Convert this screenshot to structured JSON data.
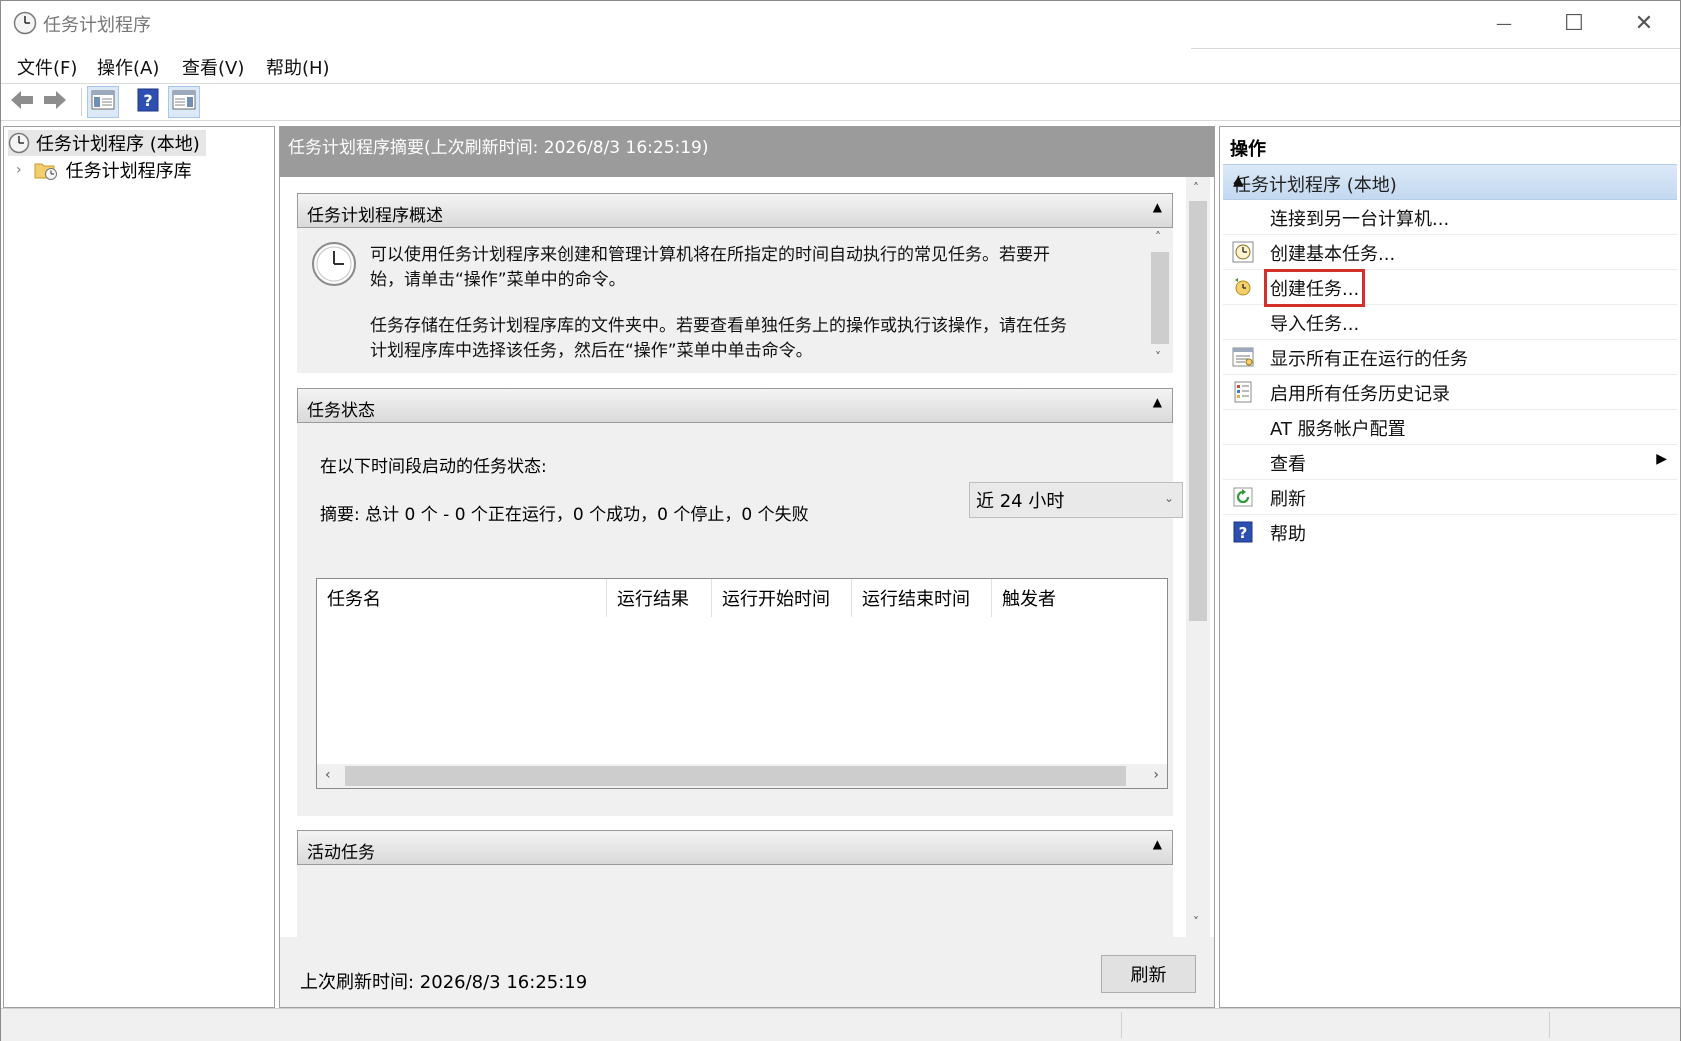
{
  "window": {
    "title": "任务计划程序",
    "controls": {
      "minimize": "—",
      "maximize": "☐",
      "close": "✕"
    }
  },
  "menubar": {
    "items": [
      "文件(F)",
      "操作(A)",
      "查看(V)",
      "帮助(H)"
    ]
  },
  "toolbar": {
    "icons": [
      "back-arrow-icon",
      "forward-arrow-icon",
      "show-hide-console-tree-icon",
      "help-icon",
      "show-hide-action-pane-icon"
    ]
  },
  "tree": {
    "root_label": "任务计划程序 (本地)",
    "child_label": "任务计划程序库"
  },
  "center": {
    "header": "任务计划程序摘要(上次刷新时间: 2026/8/3 16:25:19)",
    "overview": {
      "title": "任务计划程序概述",
      "line1": "可以使用任务计划程序来创建和管理计算机将在所指定的时间自动执行的常见任务。若要开",
      "line2": "始，请单击“操作”菜单中的命令。",
      "line3": "任务存储在任务计划程序库的文件夹中。若要查看单独任务上的操作或执行该操作，请在任务",
      "line4": "计划程序库中选择该任务，然后在“操作”菜单中单击命令。"
    },
    "status": {
      "title": "任务状态",
      "period_label": "在以下时间段启动的任务状态:",
      "period_value": "近 24 小时",
      "summary": "摘要: 总计 0 个 - 0 个正在运行，0 个成功，0 个停止，0 个失败",
      "columns": [
        "任务名",
        "运行结果",
        "运行开始时间",
        "运行结束时间",
        "触发者"
      ]
    },
    "active": {
      "title": "活动任务"
    },
    "footer": {
      "last_refresh": "上次刷新时间: 2026/8/3 16:25:19",
      "refresh_button": "刷新"
    }
  },
  "actions": {
    "title": "操作",
    "group": "任务计划程序 (本地)",
    "items": [
      {
        "label": "连接到另一台计算机...",
        "icon": "none"
      },
      {
        "label": "创建基本任务...",
        "icon": "create-basic-task-icon"
      },
      {
        "label": "创建任务...",
        "icon": "create-task-icon",
        "highlighted": true
      },
      {
        "label": "导入任务...",
        "icon": "none"
      },
      {
        "label": "显示所有正在运行的任务",
        "icon": "running-tasks-icon"
      },
      {
        "label": "启用所有任务历史记录",
        "icon": "history-icon"
      },
      {
        "label": "AT 服务帐户配置",
        "icon": "none"
      },
      {
        "label": "查看",
        "icon": "none",
        "submenu": true
      },
      {
        "label": "刷新",
        "icon": "refresh-icon"
      },
      {
        "label": "帮助",
        "icon": "help-icon"
      }
    ],
    "highlight_color": "#d2312b"
  }
}
